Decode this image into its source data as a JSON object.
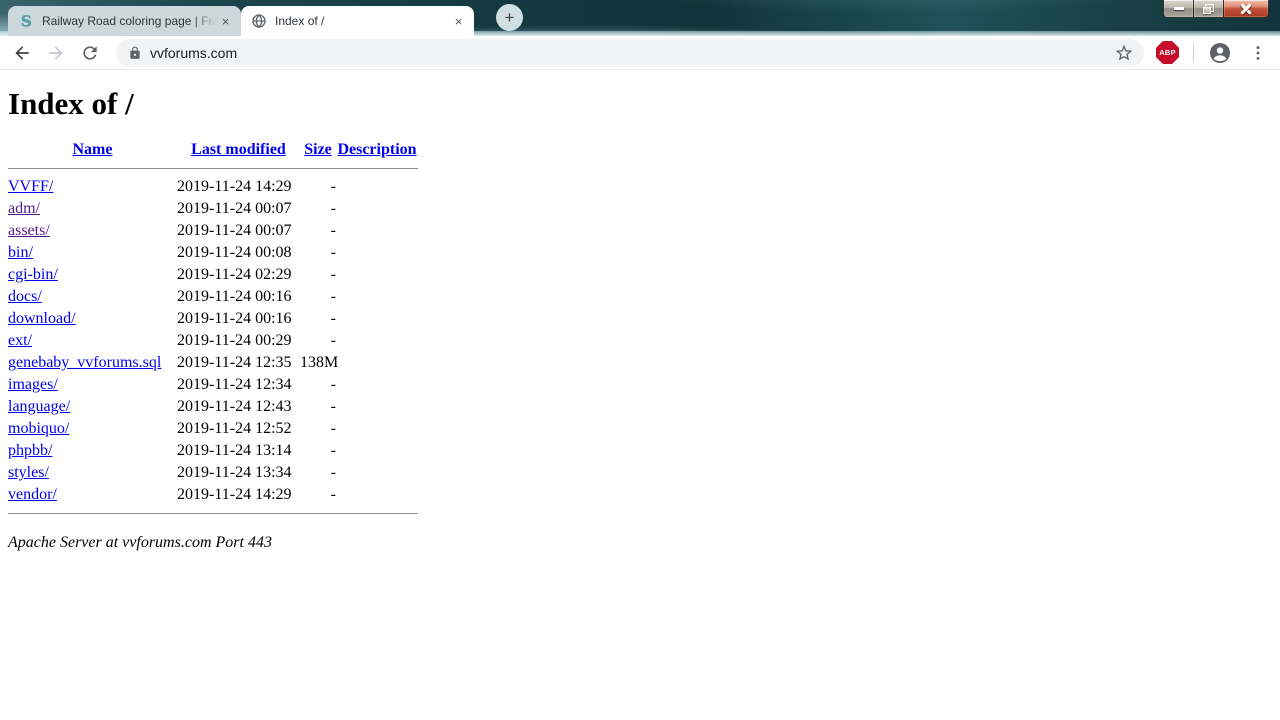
{
  "browser": {
    "tabs": [
      {
        "title": "Railway Road coloring page | Fre",
        "favicon": "supercoloring-s-logo",
        "close_icon": "×",
        "active": false
      },
      {
        "title": "Index of /",
        "favicon": "globe",
        "close_icon": "×",
        "active": true
      }
    ],
    "new_tab_icon": "+",
    "window_controls": {
      "minimize": "minimize-icon",
      "restore": "restore-icon",
      "close": "close-icon"
    },
    "toolbar": {
      "back_icon": "back-arrow-icon",
      "forward_icon": "forward-arrow-icon",
      "reload_icon": "reload-icon",
      "lock_icon": "https-padlock-icon",
      "url": "vvforums.com",
      "star_icon": "bookmark-star-icon",
      "extension_badge": "ABP",
      "profile_icon": "profile-avatar-icon",
      "menu_icon": "three-dot-menu-icon"
    }
  },
  "page": {
    "heading": "Index of /",
    "table": {
      "headers": [
        "Name",
        "Last modified",
        "Size",
        "Description"
      ],
      "rows": [
        {
          "name": "VVFF/",
          "modified": "2019-11-24 14:29",
          "size": "-",
          "description": "",
          "visited": false
        },
        {
          "name": "adm/",
          "modified": "2019-11-24 00:07",
          "size": "-",
          "description": "",
          "visited": true
        },
        {
          "name": "assets/",
          "modified": "2019-11-24 00:07",
          "size": "-",
          "description": "",
          "visited": true
        },
        {
          "name": "bin/",
          "modified": "2019-11-24 00:08",
          "size": "-",
          "description": "",
          "visited": false
        },
        {
          "name": "cgi-bin/",
          "modified": "2019-11-24 02:29",
          "size": "-",
          "description": "",
          "visited": false
        },
        {
          "name": "docs/",
          "modified": "2019-11-24 00:16",
          "size": "-",
          "description": "",
          "visited": false
        },
        {
          "name": "download/",
          "modified": "2019-11-24 00:16",
          "size": "-",
          "description": "",
          "visited": false
        },
        {
          "name": "ext/",
          "modified": "2019-11-24 00:29",
          "size": "-",
          "description": "",
          "visited": false
        },
        {
          "name": "genebaby_vvforums.sql",
          "modified": "2019-11-24 12:35",
          "size": "138M",
          "description": "",
          "visited": false
        },
        {
          "name": "images/",
          "modified": "2019-11-24 12:34",
          "size": "-",
          "description": "",
          "visited": false
        },
        {
          "name": "language/",
          "modified": "2019-11-24 12:43",
          "size": "-",
          "description": "",
          "visited": false
        },
        {
          "name": "mobiquo/",
          "modified": "2019-11-24 12:52",
          "size": "-",
          "description": "",
          "visited": false
        },
        {
          "name": "phpbb/",
          "modified": "2019-11-24 13:14",
          "size": "-",
          "description": "",
          "visited": false
        },
        {
          "name": "styles/",
          "modified": "2019-11-24 13:34",
          "size": "-",
          "description": "",
          "visited": false
        },
        {
          "name": "vendor/",
          "modified": "2019-11-24 14:29",
          "size": "-",
          "description": "",
          "visited": false
        }
      ]
    },
    "footer": "Apache Server at vvforums.com Port 443",
    "colors": {
      "link": "#0000EE",
      "visited_link": "#551A8B",
      "frame_teal": "#123a41"
    }
  }
}
